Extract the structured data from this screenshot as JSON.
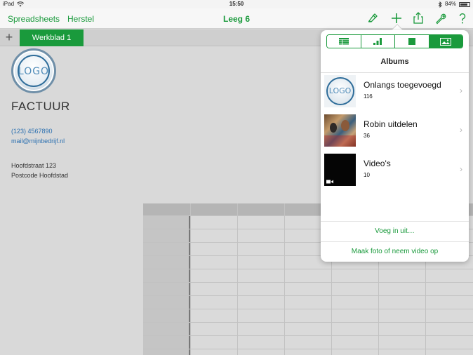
{
  "status": {
    "device": "iPad",
    "time": "15:50",
    "battery": "84%",
    "battery_level": 0.84
  },
  "nav": {
    "left_1": "Spreadsheets",
    "left_2": "Herstel",
    "title": "Leeg 6",
    "icons": [
      "paintbrush-icon",
      "plus-icon",
      "share-icon",
      "wrench-icon",
      "help-icon"
    ]
  },
  "sheets": {
    "add_icon": "+",
    "active_tab": "Werkblad 1"
  },
  "document": {
    "logo_text": "LOGO",
    "title": "FACTUUR",
    "phone": "(123) 4567890",
    "email": "mail@mijnbedrijf.nl",
    "street": "Hoofdstraat 123",
    "city": "Postcode Hoofdstad"
  },
  "popover": {
    "segments": [
      "table-icon",
      "chart-icon",
      "shape-icon",
      "media-icon"
    ],
    "active_segment": "media-icon",
    "title": "Albums",
    "albums": [
      {
        "name": "Onlangs toegevoegd",
        "count": "116"
      },
      {
        "name": "Robin uitdelen",
        "count": "36"
      },
      {
        "name": "Video's",
        "count": "10"
      }
    ],
    "insert_from": "Voeg in uit…",
    "take_photo": "Maak foto of neem video op"
  },
  "colors": {
    "accent": "#1a9a3c",
    "link_blue": "#2a6fb0"
  }
}
